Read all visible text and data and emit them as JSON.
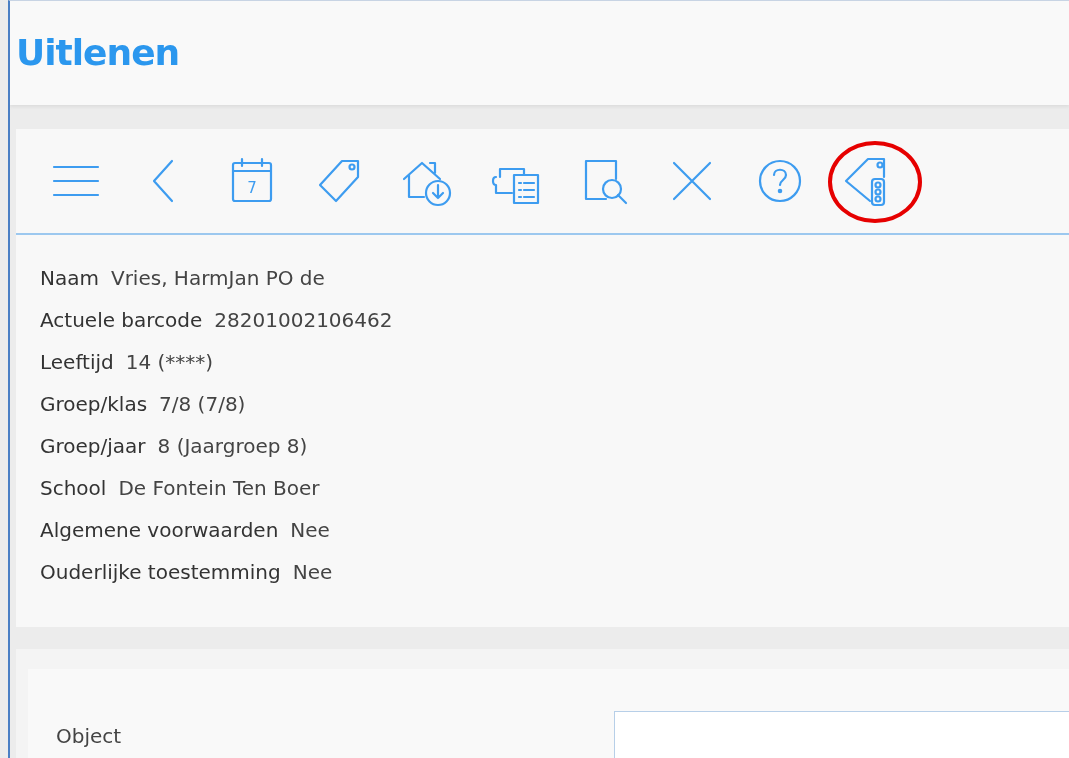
{
  "title": "Uitlenen",
  "toolbar": [
    {
      "kind": "menu",
      "highlighted": false
    },
    {
      "kind": "back",
      "highlighted": false
    },
    {
      "kind": "calendar",
      "highlighted": false,
      "day": "7"
    },
    {
      "kind": "tag",
      "highlighted": false
    },
    {
      "kind": "home-download",
      "highlighted": false
    },
    {
      "kind": "list",
      "highlighted": false
    },
    {
      "kind": "doc-search",
      "highlighted": false
    },
    {
      "kind": "close",
      "highlighted": false
    },
    {
      "kind": "help",
      "highlighted": false
    },
    {
      "kind": "tag-traffic",
      "highlighted": true
    }
  ],
  "details": [
    {
      "label": "Naam",
      "value": "Vries, HarmJan PO de"
    },
    {
      "label": "Actuele barcode",
      "value": "28201002106462"
    },
    {
      "label": "Leeftijd",
      "value": "14 (****)"
    },
    {
      "label": "Groep/klas",
      "value": "7/8 (7/8)"
    },
    {
      "label": "Groep/jaar",
      "value": "8 (Jaargroep 8)"
    },
    {
      "label": "School",
      "value": "De Fontein Ten Boer"
    },
    {
      "label": "Algemene voorwaarden",
      "value": "Nee"
    },
    {
      "label": "Ouderlijke toestemming",
      "value": "Nee"
    }
  ],
  "form": {
    "label": "Object"
  }
}
